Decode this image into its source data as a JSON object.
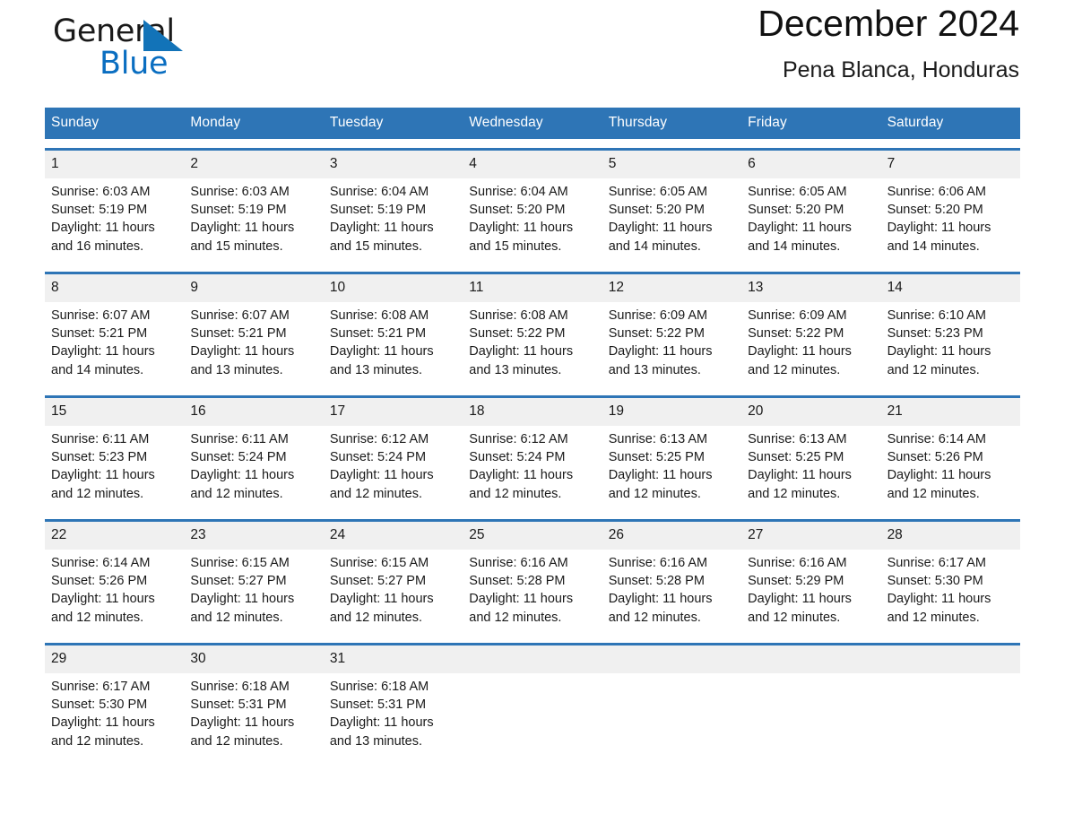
{
  "brand": {
    "word_one": "General",
    "word_two": "Blue",
    "triangle_color": "#1273b8",
    "blue_text_color": "#0a6ec1"
  },
  "header": {
    "title": "December 2024",
    "subtitle": "Pena Blanca, Honduras"
  },
  "theme": {
    "header_blue": "#2e75b6",
    "daynum_band": "#f0f0f0",
    "cell_background": "#ffffff",
    "text": "#1a1a1a"
  },
  "weekdays": [
    "Sunday",
    "Monday",
    "Tuesday",
    "Wednesday",
    "Thursday",
    "Friday",
    "Saturday"
  ],
  "weeks": [
    {
      "daynums": [
        "1",
        "2",
        "3",
        "4",
        "5",
        "6",
        "7"
      ],
      "days": [
        {
          "sunrise": "Sunrise: 6:03 AM",
          "sunset": "Sunset: 5:19 PM",
          "daylight_1": "Daylight: 11 hours",
          "daylight_2": "and 16 minutes."
        },
        {
          "sunrise": "Sunrise: 6:03 AM",
          "sunset": "Sunset: 5:19 PM",
          "daylight_1": "Daylight: 11 hours",
          "daylight_2": "and 15 minutes."
        },
        {
          "sunrise": "Sunrise: 6:04 AM",
          "sunset": "Sunset: 5:19 PM",
          "daylight_1": "Daylight: 11 hours",
          "daylight_2": "and 15 minutes."
        },
        {
          "sunrise": "Sunrise: 6:04 AM",
          "sunset": "Sunset: 5:20 PM",
          "daylight_1": "Daylight: 11 hours",
          "daylight_2": "and 15 minutes."
        },
        {
          "sunrise": "Sunrise: 6:05 AM",
          "sunset": "Sunset: 5:20 PM",
          "daylight_1": "Daylight: 11 hours",
          "daylight_2": "and 14 minutes."
        },
        {
          "sunrise": "Sunrise: 6:05 AM",
          "sunset": "Sunset: 5:20 PM",
          "daylight_1": "Daylight: 11 hours",
          "daylight_2": "and 14 minutes."
        },
        {
          "sunrise": "Sunrise: 6:06 AM",
          "sunset": "Sunset: 5:20 PM",
          "daylight_1": "Daylight: 11 hours",
          "daylight_2": "and 14 minutes."
        }
      ]
    },
    {
      "daynums": [
        "8",
        "9",
        "10",
        "11",
        "12",
        "13",
        "14"
      ],
      "days": [
        {
          "sunrise": "Sunrise: 6:07 AM",
          "sunset": "Sunset: 5:21 PM",
          "daylight_1": "Daylight: 11 hours",
          "daylight_2": "and 14 minutes."
        },
        {
          "sunrise": "Sunrise: 6:07 AM",
          "sunset": "Sunset: 5:21 PM",
          "daylight_1": "Daylight: 11 hours",
          "daylight_2": "and 13 minutes."
        },
        {
          "sunrise": "Sunrise: 6:08 AM",
          "sunset": "Sunset: 5:21 PM",
          "daylight_1": "Daylight: 11 hours",
          "daylight_2": "and 13 minutes."
        },
        {
          "sunrise": "Sunrise: 6:08 AM",
          "sunset": "Sunset: 5:22 PM",
          "daylight_1": "Daylight: 11 hours",
          "daylight_2": "and 13 minutes."
        },
        {
          "sunrise": "Sunrise: 6:09 AM",
          "sunset": "Sunset: 5:22 PM",
          "daylight_1": "Daylight: 11 hours",
          "daylight_2": "and 13 minutes."
        },
        {
          "sunrise": "Sunrise: 6:09 AM",
          "sunset": "Sunset: 5:22 PM",
          "daylight_1": "Daylight: 11 hours",
          "daylight_2": "and 12 minutes."
        },
        {
          "sunrise": "Sunrise: 6:10 AM",
          "sunset": "Sunset: 5:23 PM",
          "daylight_1": "Daylight: 11 hours",
          "daylight_2": "and 12 minutes."
        }
      ]
    },
    {
      "daynums": [
        "15",
        "16",
        "17",
        "18",
        "19",
        "20",
        "21"
      ],
      "days": [
        {
          "sunrise": "Sunrise: 6:11 AM",
          "sunset": "Sunset: 5:23 PM",
          "daylight_1": "Daylight: 11 hours",
          "daylight_2": "and 12 minutes."
        },
        {
          "sunrise": "Sunrise: 6:11 AM",
          "sunset": "Sunset: 5:24 PM",
          "daylight_1": "Daylight: 11 hours",
          "daylight_2": "and 12 minutes."
        },
        {
          "sunrise": "Sunrise: 6:12 AM",
          "sunset": "Sunset: 5:24 PM",
          "daylight_1": "Daylight: 11 hours",
          "daylight_2": "and 12 minutes."
        },
        {
          "sunrise": "Sunrise: 6:12 AM",
          "sunset": "Sunset: 5:24 PM",
          "daylight_1": "Daylight: 11 hours",
          "daylight_2": "and 12 minutes."
        },
        {
          "sunrise": "Sunrise: 6:13 AM",
          "sunset": "Sunset: 5:25 PM",
          "daylight_1": "Daylight: 11 hours",
          "daylight_2": "and 12 minutes."
        },
        {
          "sunrise": "Sunrise: 6:13 AM",
          "sunset": "Sunset: 5:25 PM",
          "daylight_1": "Daylight: 11 hours",
          "daylight_2": "and 12 minutes."
        },
        {
          "sunrise": "Sunrise: 6:14 AM",
          "sunset": "Sunset: 5:26 PM",
          "daylight_1": "Daylight: 11 hours",
          "daylight_2": "and 12 minutes."
        }
      ]
    },
    {
      "daynums": [
        "22",
        "23",
        "24",
        "25",
        "26",
        "27",
        "28"
      ],
      "days": [
        {
          "sunrise": "Sunrise: 6:14 AM",
          "sunset": "Sunset: 5:26 PM",
          "daylight_1": "Daylight: 11 hours",
          "daylight_2": "and 12 minutes."
        },
        {
          "sunrise": "Sunrise: 6:15 AM",
          "sunset": "Sunset: 5:27 PM",
          "daylight_1": "Daylight: 11 hours",
          "daylight_2": "and 12 minutes."
        },
        {
          "sunrise": "Sunrise: 6:15 AM",
          "sunset": "Sunset: 5:27 PM",
          "daylight_1": "Daylight: 11 hours",
          "daylight_2": "and 12 minutes."
        },
        {
          "sunrise": "Sunrise: 6:16 AM",
          "sunset": "Sunset: 5:28 PM",
          "daylight_1": "Daylight: 11 hours",
          "daylight_2": "and 12 minutes."
        },
        {
          "sunrise": "Sunrise: 6:16 AM",
          "sunset": "Sunset: 5:28 PM",
          "daylight_1": "Daylight: 11 hours",
          "daylight_2": "and 12 minutes."
        },
        {
          "sunrise": "Sunrise: 6:16 AM",
          "sunset": "Sunset: 5:29 PM",
          "daylight_1": "Daylight: 11 hours",
          "daylight_2": "and 12 minutes."
        },
        {
          "sunrise": "Sunrise: 6:17 AM",
          "sunset": "Sunset: 5:30 PM",
          "daylight_1": "Daylight: 11 hours",
          "daylight_2": "and 12 minutes."
        }
      ]
    },
    {
      "daynums": [
        "29",
        "30",
        "31",
        "",
        "",
        "",
        ""
      ],
      "days": [
        {
          "sunrise": "Sunrise: 6:17 AM",
          "sunset": "Sunset: 5:30 PM",
          "daylight_1": "Daylight: 11 hours",
          "daylight_2": "and 12 minutes."
        },
        {
          "sunrise": "Sunrise: 6:18 AM",
          "sunset": "Sunset: 5:31 PM",
          "daylight_1": "Daylight: 11 hours",
          "daylight_2": "and 12 minutes."
        },
        {
          "sunrise": "Sunrise: 6:18 AM",
          "sunset": "Sunset: 5:31 PM",
          "daylight_1": "Daylight: 11 hours",
          "daylight_2": "and 13 minutes."
        },
        {
          "sunrise": "",
          "sunset": "",
          "daylight_1": "",
          "daylight_2": ""
        },
        {
          "sunrise": "",
          "sunset": "",
          "daylight_1": "",
          "daylight_2": ""
        },
        {
          "sunrise": "",
          "sunset": "",
          "daylight_1": "",
          "daylight_2": ""
        },
        {
          "sunrise": "",
          "sunset": "",
          "daylight_1": "",
          "daylight_2": ""
        }
      ]
    }
  ]
}
